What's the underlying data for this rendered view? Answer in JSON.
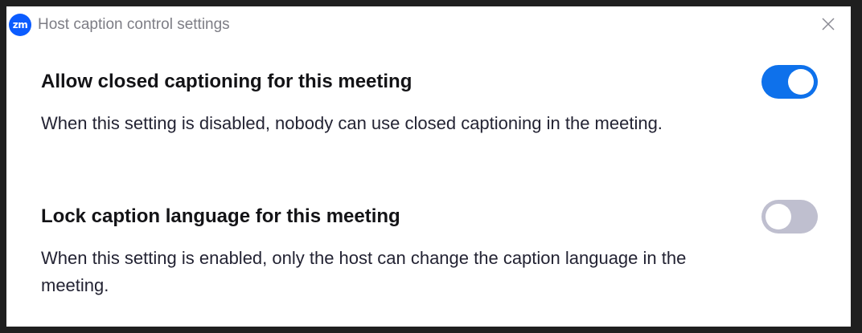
{
  "window": {
    "title": "Host caption control settings",
    "logo_text": "zm",
    "logo_icon": "zoom-logo-icon",
    "close_icon": "close-icon"
  },
  "settings": [
    {
      "title": "Allow closed captioning for this meeting",
      "description": "When this setting is disabled, nobody can use closed captioning in the meeting.",
      "enabled": true
    },
    {
      "title": "Lock caption language for this meeting",
      "description": "When this setting is enabled, only the host can change the caption language in the meeting.",
      "enabled": false
    }
  ],
  "colors": {
    "toggle_on": "#0e71eb",
    "toggle_off": "#bfbfcf",
    "brand": "#0b5cff"
  }
}
